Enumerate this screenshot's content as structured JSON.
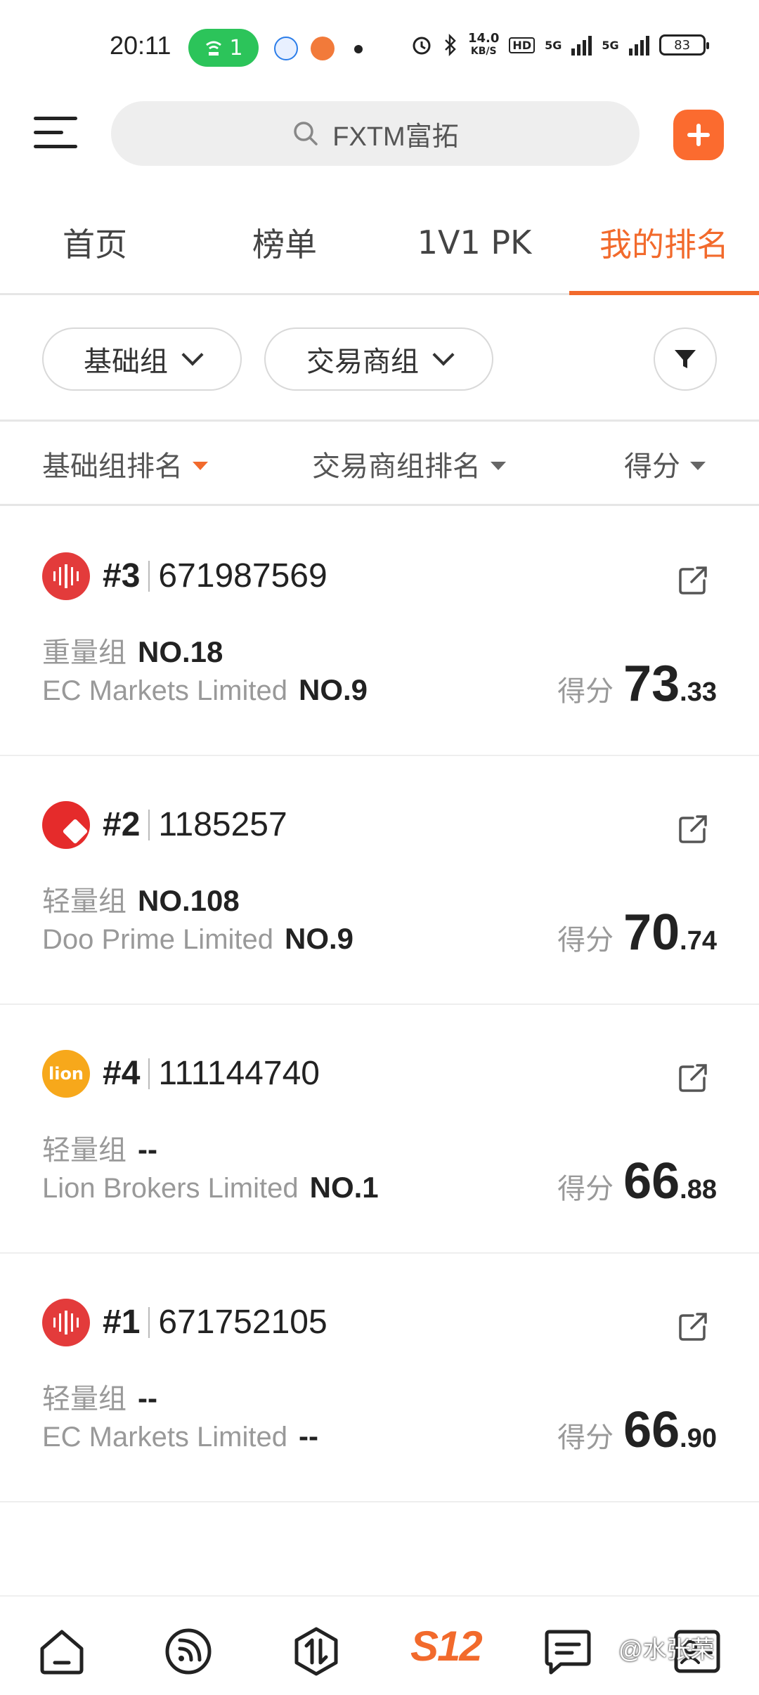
{
  "status_bar": {
    "time": "20:11",
    "hotspot_count": "1",
    "net_speed_value": "14.0",
    "net_speed_unit": "KB/S",
    "hd_label": "HD",
    "net1_label": "5G",
    "net2_label": "5G",
    "battery": "83"
  },
  "search": {
    "placeholder": "FXTM富拓"
  },
  "tabs": [
    {
      "label": "首页",
      "active": false
    },
    {
      "label": "榜单",
      "active": false
    },
    {
      "label": "1V1 PK",
      "active": false
    },
    {
      "label": "我的排名",
      "active": true
    }
  ],
  "filters": {
    "group": "基础组",
    "broker_group": "交易商组"
  },
  "sort": {
    "basic_rank": "基础组排名",
    "broker_rank": "交易商组排名",
    "score": "得分"
  },
  "score_label": "得分",
  "cards": [
    {
      "logo": "ec-markets-logo",
      "rank": "#3",
      "account": "671987569",
      "group_label": "重量组",
      "group_rank": "NO.18",
      "broker": "EC Markets Limited",
      "broker_rank": "NO.9",
      "score_int": "73",
      "score_dec": ".33"
    },
    {
      "logo": "doo-prime-logo",
      "rank": "#2",
      "account": "1185257",
      "group_label": "轻量组",
      "group_rank": "NO.108",
      "broker": "Doo Prime Limited",
      "broker_rank": "NO.9",
      "score_int": "70",
      "score_dec": ".74"
    },
    {
      "logo": "lion-brokers-logo",
      "logo_text": "lion",
      "rank": "#4",
      "account": "111144740",
      "group_label": "轻量组",
      "group_rank": "--",
      "broker": "Lion Brokers Limited",
      "broker_rank": "NO.1",
      "score_int": "66",
      "score_dec": ".88"
    },
    {
      "logo": "ec-markets-logo",
      "rank": "#1",
      "account": "671752105",
      "group_label": "轻量组",
      "group_rank": "--",
      "broker": "EC Markets Limited",
      "broker_rank": "--",
      "score_int": "66",
      "score_dec": ".90"
    }
  ],
  "bottom_nav": {
    "s12_label": "S12",
    "watermark": "@水张荣"
  },
  "colors": {
    "accent": "#f26a2c",
    "add_button": "#fb6b2f",
    "hotspot": "#2cc45a"
  }
}
